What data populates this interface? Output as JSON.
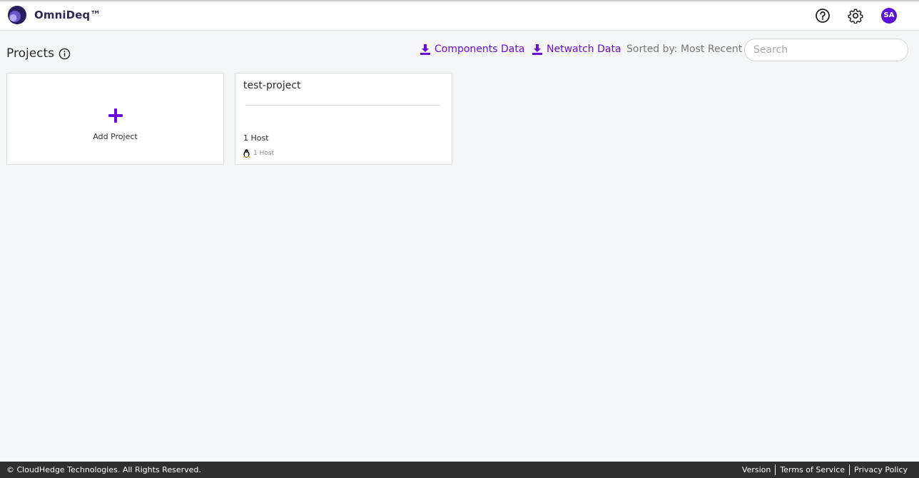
{
  "app": {
    "name": "OmniDeq™"
  },
  "header": {
    "icons": [
      "help-icon",
      "gear-icon"
    ],
    "avatar_initials": "SA",
    "accent": "#5b12d6"
  },
  "page": {
    "title": "Projects",
    "actions": {
      "components_label": "Components Data",
      "netwatch_label": "Netwatch Data"
    },
    "sort_label": "Sorted by: Most Recent",
    "search": {
      "placeholder": "Search",
      "value": ""
    }
  },
  "cards": {
    "add": {
      "label": "Add Project"
    },
    "projects": [
      {
        "name": "test-project",
        "hosts_label": "1 Host",
        "os_icon": "linux-icon",
        "os_hosts_label": "1 Host"
      }
    ]
  },
  "footer": {
    "copyright": "© CloudHedge Technologies. All Rights Reserved.",
    "links": [
      "Version",
      "Terms of Service",
      "Privacy Policy"
    ]
  },
  "colors": {
    "accent": "#6a0dd6",
    "footer_bg": "#2f2f2f",
    "page_bg": "#f5f6f8"
  }
}
